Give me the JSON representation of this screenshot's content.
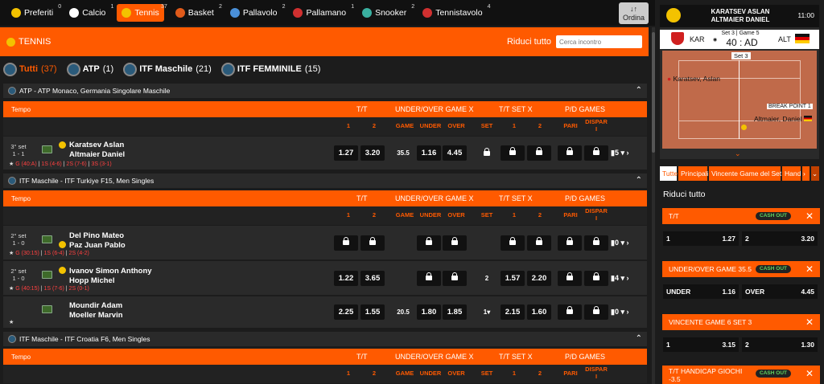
{
  "nav": [
    {
      "label": "Preferiti",
      "count": "0",
      "color": "#f3c200"
    },
    {
      "label": "Calcio",
      "count": "1",
      "color": "#ffffff"
    },
    {
      "label": "Tennis",
      "count": "37",
      "color": "#f3c200",
      "active": true
    },
    {
      "label": "Basket",
      "count": "2",
      "color": "#e05a1a"
    },
    {
      "label": "Pallavolo",
      "count": "2",
      "color": "#4a90d9"
    },
    {
      "label": "Pallamano",
      "count": "1",
      "color": "#d03030"
    },
    {
      "label": "Snooker",
      "count": "2",
      "color": "#3ab0a0"
    },
    {
      "label": "Tennistavolo",
      "count": "4",
      "color": "#d03030"
    }
  ],
  "ordina": {
    "icon": "↓↑",
    "label": "Ordina"
  },
  "tennis": {
    "title": "TENNIS",
    "riduci": "Riduci tutto",
    "search_placeholder": "Cerca incontro"
  },
  "filters": [
    {
      "label": "Tutti",
      "count": "(37)"
    },
    {
      "label": "ATP",
      "count": "(1)"
    },
    {
      "label": "ITF Maschile",
      "count": "(21)"
    },
    {
      "label": "ITF FEMMINILE",
      "count": "(15)"
    }
  ],
  "header": {
    "tempo": "Tempo",
    "tt": "T/T",
    "uo": "UNDER/OVER GAME X",
    "ttset": "T/T SET X",
    "pd": "P/D GAMES"
  },
  "subheader": {
    "c1": "1",
    "c2": "2",
    "game": "GAME",
    "under": "UNDER",
    "over": "OVER",
    "set": "SET",
    "s1": "1",
    "s2": "2",
    "pari": "PARI",
    "dispari": "DISPAR I"
  },
  "leagues": [
    {
      "name": "ATP - ATP Monaco, Germania Singolare Maschile"
    },
    {
      "name": "ITF Maschile - ITF Turkiye F15, Men Singles"
    },
    {
      "name": "ITF Maschile - ITF Croatia F6, Men Singles"
    }
  ],
  "matches": [
    {
      "set": "3° set",
      "score": "1 - 1",
      "p1": "Karatsev Aslan",
      "p2": "Altmaier Daniel",
      "game": "G (40:A)",
      "s1": "1S (4-6)",
      "s2": "2S (7-6)",
      "s3": "3S (3-1)",
      "o1": "1.27",
      "o2": "3.20",
      "line": "35.5",
      "under": "1.16",
      "over": "4.45",
      "more": "5"
    },
    {
      "set": "2° set",
      "score": "1 - 0",
      "p1": "Del Pino Mateo",
      "p2": "Paz Juan Pablo",
      "game": "G (30:15)",
      "s1": "1S (6-4)",
      "s2": "2S (4-2)",
      "more": "0"
    },
    {
      "set": "2° set",
      "score": "1 - 0",
      "p1": "Ivanov Simon Anthony",
      "p2": "Hopp Michel",
      "game": "G (40:15)",
      "s1": "1S (7-6)",
      "s2": "2S (0-1)",
      "o1": "1.22",
      "o2": "3.65",
      "setn": "2",
      "ts1": "1.57",
      "ts2": "2.20",
      "more": "4"
    },
    {
      "p1": "Moundir Adam",
      "p2": "Moeller Marvin",
      "o1": "2.25",
      "o2": "1.55",
      "line": "20.5",
      "under": "1.80",
      "over": "1.85",
      "setn": "1",
      "ts1": "2.15",
      "ts2": "1.60",
      "more": "0"
    }
  ],
  "panel": {
    "p1": "KARATSEV ASLAN",
    "p2": "ALTMAIER DANIEL",
    "time": "11:00",
    "kar": "KAR",
    "alt": "ALT",
    "setgame": "Set 3 | Game 5",
    "points": "40 : AD",
    "setlabel": "Set 3",
    "court_p1": "Karatsev, Aslan",
    "court_p2": "Altmaier, Daniel",
    "bp": "BREAK POINT 1",
    "tabs": [
      "Tutte",
      "Principali",
      "Vincente Game del Set",
      "Handi"
    ],
    "riduci": "Riduci tutto",
    "cashout": "CASH OUT",
    "markets": [
      {
        "title": "T/T",
        "a": "1",
        "av": "1.27",
        "b": "2",
        "bv": "3.20"
      },
      {
        "title": "UNDER/OVER GAME 35.5",
        "a": "UNDER",
        "av": "1.16",
        "b": "OVER",
        "bv": "4.45"
      },
      {
        "title": "VINCENTE GAME 6 SET 3",
        "a": "1",
        "av": "3.15",
        "b": "2",
        "bv": "1.30"
      },
      {
        "title": "T/T HANDICAP GIOCHI -3.5"
      }
    ]
  }
}
